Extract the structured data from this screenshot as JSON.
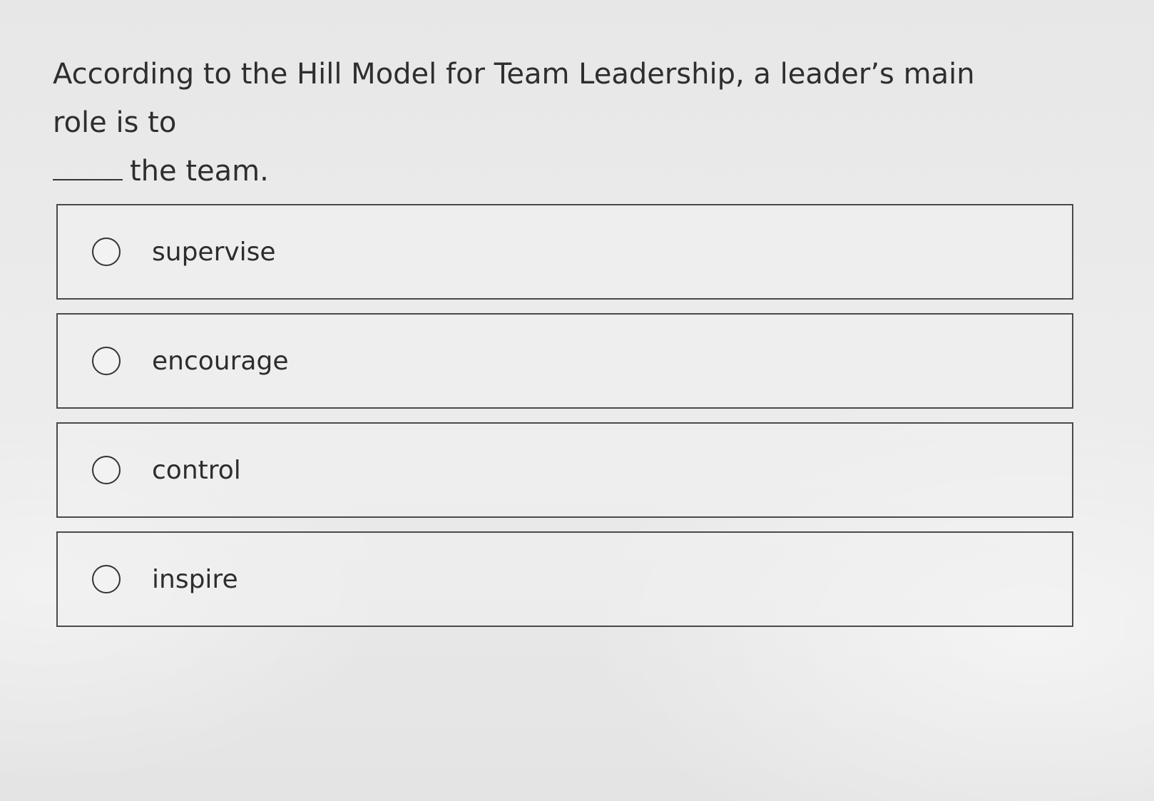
{
  "question": {
    "text_before_blank": "According to the Hill Model for Team Leadership, a leader’s main role is to",
    "text_after_blank": "the team."
  },
  "options": [
    {
      "label": "supervise",
      "selected": false
    },
    {
      "label": "encourage",
      "selected": false
    },
    {
      "label": "control",
      "selected": false
    },
    {
      "label": "inspire",
      "selected": false
    }
  ]
}
